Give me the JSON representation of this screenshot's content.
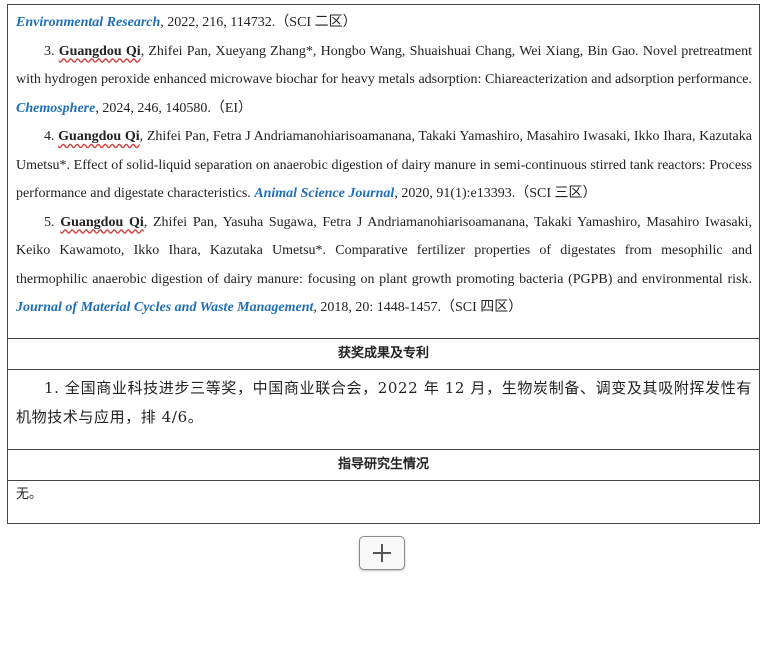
{
  "publications": {
    "continued": {
      "journal": "Environmental Research",
      "tail": ", 2022, 216, 114732.（SCI 二区）"
    },
    "item3": {
      "num": "3. ",
      "self": "Guangdou Qi",
      "authors": ", Zhifei Pan, Xueyang Zhang*, Hongbo Wang, Shuaishuai Chang, Wei Xiang, Bin Gao. ",
      "title": "Novel pretreatment with hydrogen peroxide enhanced microwave biochar for heavy metals adsorption: Chiareacterization and adsorption performance. ",
      "journal": "Chemosphere",
      "tail": ", 2024, 246, 140580.（EI）"
    },
    "item4": {
      "num": "4. ",
      "self": "Guangdou Qi",
      "authors": ", Zhifei Pan, Fetra J Andriamanohiarisoamanana, Takaki Yamashiro, Masahiro Iwasaki, Ikko Ihara, Kazutaka Umetsu*. ",
      "title": "Effect of solid-liquid separation on anaerobic digestion of dairy manure in semi-continuous stirred tank reactors: Process performance and digestate characteristics. ",
      "journal": "Animal Science Journal",
      "tail": ", 2020, 91(1):e13393.（SCI 三区）"
    },
    "item5": {
      "num": "5. ",
      "self": "Guangdou Qi",
      "authors": ", Zhifei Pan, Yasuha Sugawa, Fetra J Andriamanohiarisoamanana, Takaki Yamashiro, Masahiro Iwasaki, Keiko Kawamoto, Ikko Ihara, Kazutaka Umetsu*. ",
      "title": "Comparative fertilizer properties of digestates from mesophilic and thermophilic anaerobic digestion of dairy manure: focusing on plant growth promoting bacteria (PGPB) and environmental risk. ",
      "journal": "Journal of Material Cycles and Waste Management",
      "tail": ", 2018, 20: 1448-1457.（SCI 四区）"
    }
  },
  "awards": {
    "heading": "获奖成果及专利",
    "item1": "1. 全国商业科技进步三等奖，中国商业联合会，2022 年 12 月，生物炭制备、调变及其吸附挥发性有机物技术与应用，排 4/6。"
  },
  "students": {
    "heading": "指导研究生情况",
    "content": "无。"
  },
  "colors": {
    "journal": "#1f6fb8",
    "spellcheck": "#d04040",
    "border": "#444444"
  },
  "icons": {
    "add": "plus-icon"
  }
}
